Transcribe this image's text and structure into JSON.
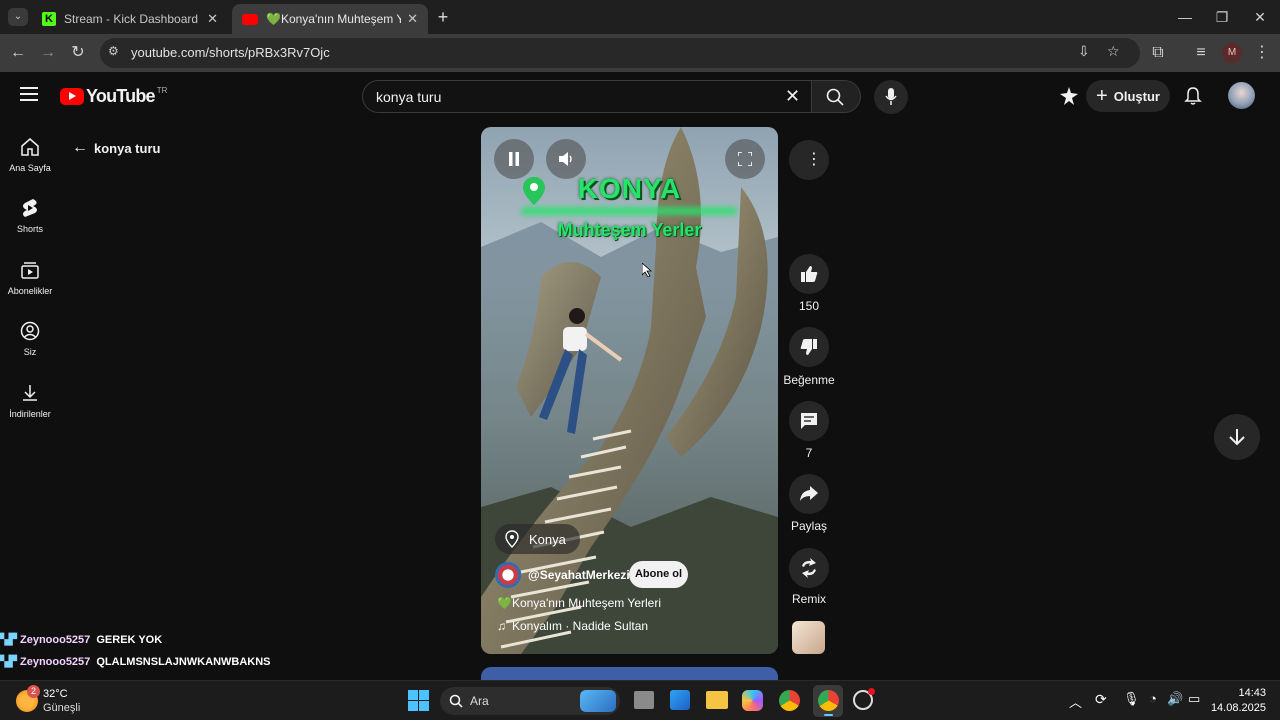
{
  "browser": {
    "tabs": [
      {
        "title": "Stream - Kick Dashboard",
        "active": false
      },
      {
        "title": "💚Konya'nın Muhteşem Yerleri",
        "active": true
      }
    ],
    "url": "youtube.com/shorts/pRBx3Rv7Ojc",
    "profile_initial": "M"
  },
  "youtube": {
    "logo_text": "YouTube",
    "region": "TR",
    "search_value": "konya turu",
    "create_label": "Oluştur",
    "back_label": "konya turu",
    "sidebar": [
      {
        "label": "Ana Sayfa",
        "icon": "home-icon"
      },
      {
        "label": "Shorts",
        "icon": "shorts-icon"
      },
      {
        "label": "Abonelikler",
        "icon": "subscriptions-icon"
      },
      {
        "label": "Siz",
        "icon": "you-icon"
      },
      {
        "label": "İndirilenler",
        "icon": "downloads-icon"
      }
    ]
  },
  "video": {
    "overlay_title": "KONYA",
    "overlay_subtitle": "Muhteşem Yerler",
    "location": "Konya",
    "channel": "@SeyahatMerkezi",
    "subscribe_label": "Abone ol",
    "title": "💚Konya'nın Muhteşem Yerleri",
    "music": "Konyalım · Nadide Sultan"
  },
  "actions": {
    "likes": "150",
    "dislike_label": "Beğenme",
    "comments": "7",
    "share_label": "Paylaş",
    "remix_label": "Remix"
  },
  "chat": [
    {
      "user": "Zeynooo5257",
      "message": "GEREK YOK"
    },
    {
      "user": "Zeynooo5257",
      "message": "QLALMSNSLAJNWKANWBAKNS"
    }
  ],
  "taskbar": {
    "weather_temp": "32°C",
    "weather_desc": "Güneşli",
    "weather_badge": "2",
    "search_label": "Ara",
    "time": "14:43",
    "date": "14.08.2025"
  },
  "colors": {
    "youtube_red": "#ff0000",
    "kick_green": "#53fc18",
    "overlay_green": "#27e36b"
  }
}
